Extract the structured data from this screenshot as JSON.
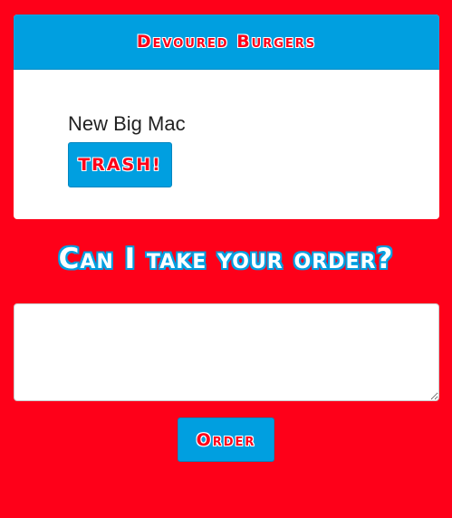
{
  "header": {
    "title": "Devoured Burgers"
  },
  "burgers": [
    {
      "name": "New Big Mac",
      "button_label": "TRASH!"
    }
  ],
  "order_section": {
    "heading": "Can I take your order?",
    "input_value": "",
    "submit_label": "Order"
  },
  "colors": {
    "background": "#fe0019",
    "accent": "#009fe0",
    "card": "#ffffff"
  }
}
